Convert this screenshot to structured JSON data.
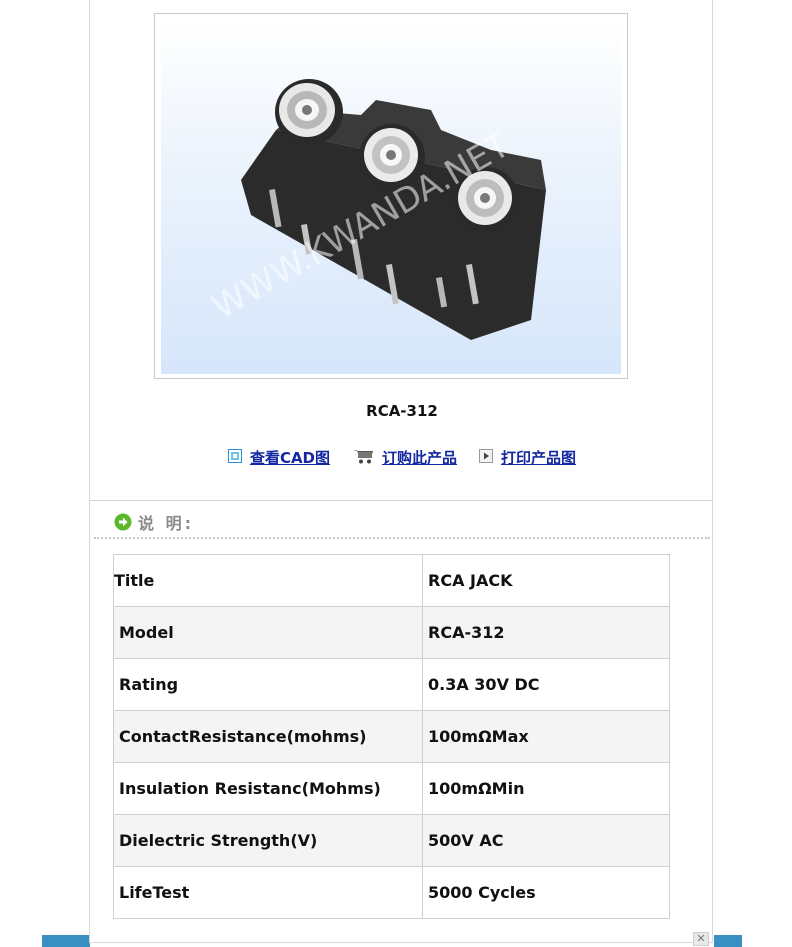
{
  "product": {
    "code": "RCA-312",
    "image_alt": "RCA-312 product photo",
    "watermark": "WWW.KWANDA.NET"
  },
  "actions": [
    {
      "label": "查看CAD图",
      "icon": "cad-icon"
    },
    {
      "label": "订购此产品",
      "icon": "cart-icon"
    },
    {
      "label": "打印产品图",
      "icon": "print-arrow-icon"
    }
  ],
  "section": {
    "title": "说 明:",
    "icon": "green-arrow-icon"
  },
  "specs": [
    {
      "key": "Title",
      "value": "RCA JACK"
    },
    {
      "key": "Model",
      "value": "RCA-312"
    },
    {
      "key": "Rating",
      "value": "0.3A 30V DC"
    },
    {
      "key": "ContactResistance(mohms)",
      "value": "100mΩMax"
    },
    {
      "key": "Insulation Resistanc(Mohms)",
      "value": "100mΩMin"
    },
    {
      "key": "Dielectric Strength(V)",
      "value": "500V AC"
    },
    {
      "key": "LifeTest",
      "value": "5000 Cycles"
    }
  ],
  "close_glyph": "✕",
  "colors": {
    "link": "#1428a0",
    "accent_blue": "#3a8fc3",
    "section_title": "#8a8a8a",
    "green_icon": "#5cb82b"
  }
}
